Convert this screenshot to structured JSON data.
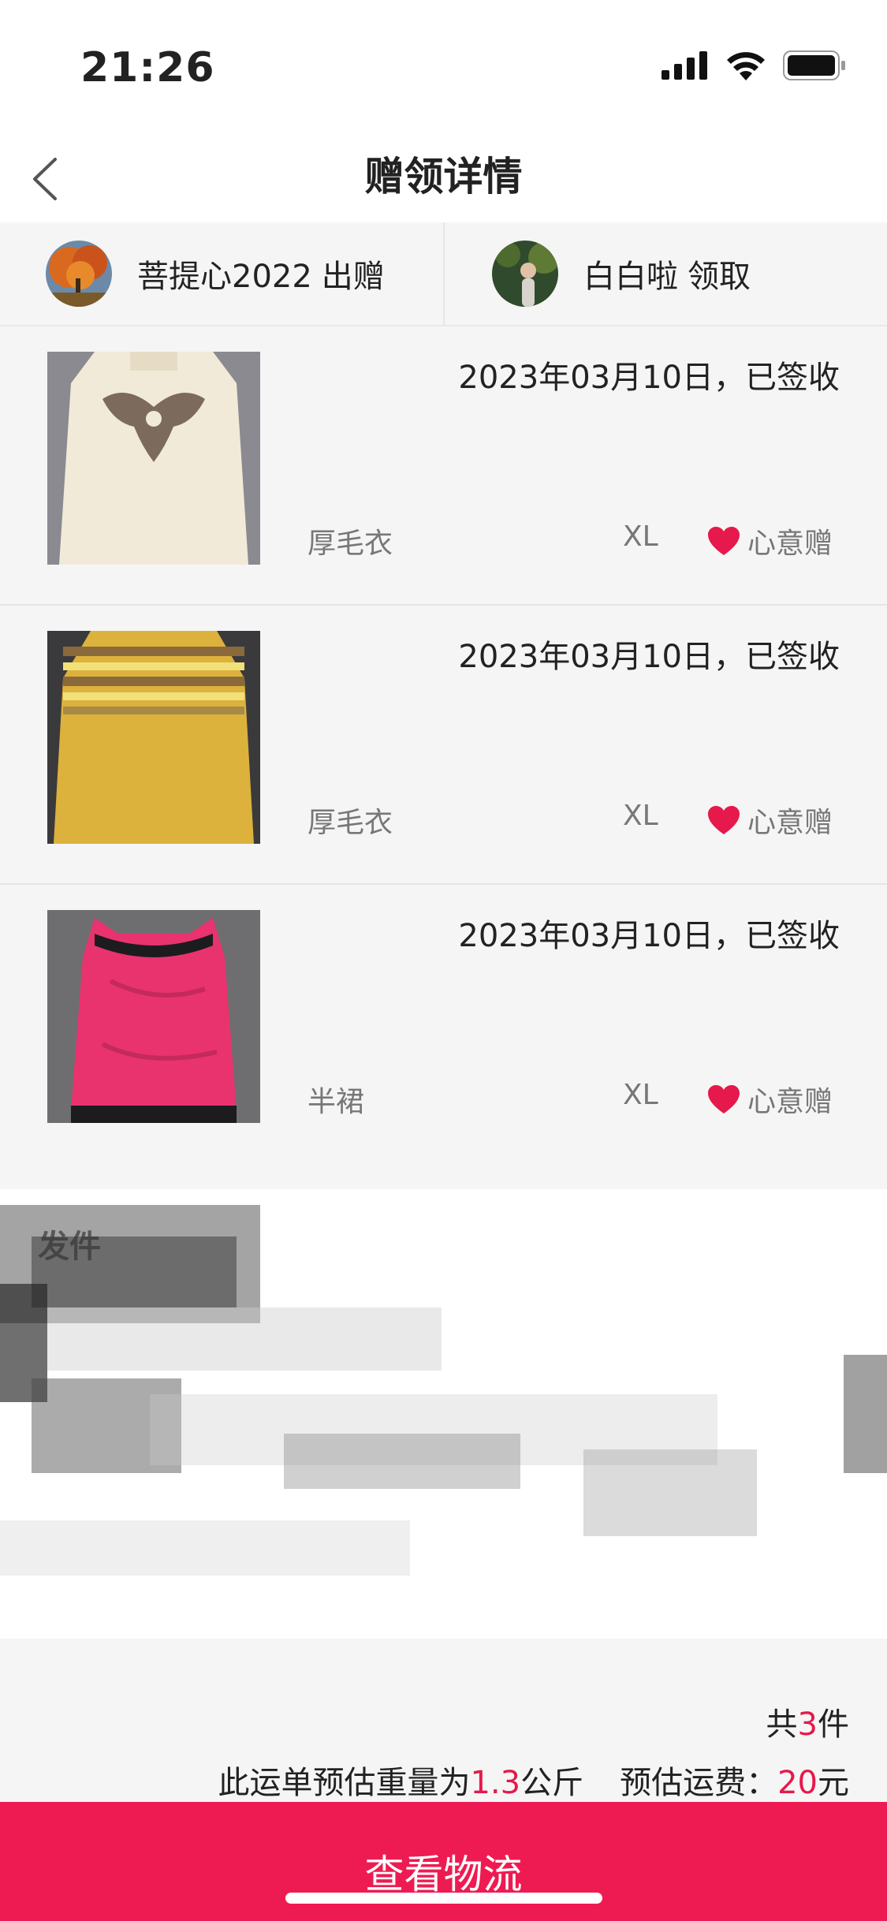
{
  "status_bar": {
    "time": "21:26"
  },
  "nav": {
    "title": "赠领详情"
  },
  "parties": {
    "giver": {
      "name": "菩提心2022",
      "action": "出赠"
    },
    "receiver": {
      "name": "白白啦",
      "action": "领取"
    }
  },
  "items": [
    {
      "status": "2023年03月10日，已签收",
      "name": "厚毛衣",
      "size": "XL",
      "tag": "心意赠"
    },
    {
      "status": "2023年03月10日，已签收",
      "name": "厚毛衣",
      "size": "XL",
      "tag": "心意赠"
    },
    {
      "status": "2023年03月10日，已签收",
      "name": "半裙",
      "size": "XL",
      "tag": "心意赠"
    }
  ],
  "shipping": {
    "sender_label": "发件",
    "total_prefix": "共",
    "total_count": "3",
    "total_suffix": "件",
    "weight_prefix": "此运单预估重量为",
    "weight_value": "1.3",
    "weight_unit": "公斤",
    "fee_label": "预估运费：",
    "fee_value": "20",
    "fee_unit": "元"
  },
  "cta": {
    "label": "查看物流"
  },
  "colors": {
    "accent": "#ee1b52",
    "heart": "#e5194b"
  }
}
